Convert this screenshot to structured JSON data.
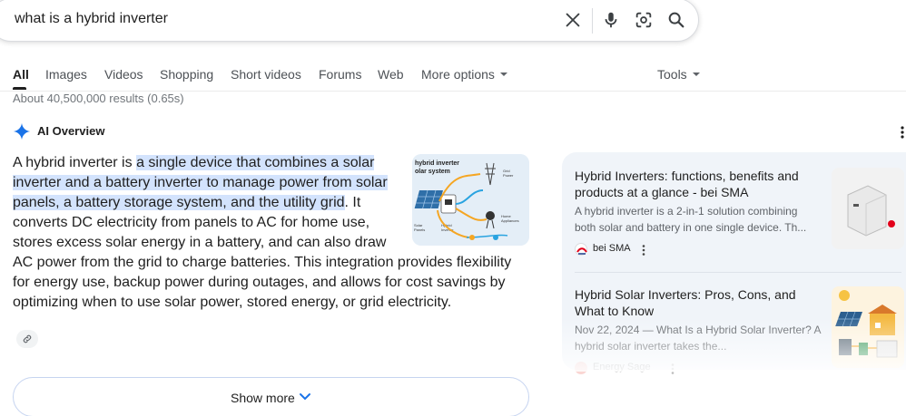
{
  "search": {
    "query": "what is a hybrid inverter"
  },
  "tabs": [
    {
      "label": "All"
    },
    {
      "label": "Images"
    },
    {
      "label": "Videos"
    },
    {
      "label": "Shopping"
    },
    {
      "label": "Short videos"
    },
    {
      "label": "Forums"
    },
    {
      "label": "Web"
    },
    {
      "label": "More options"
    }
  ],
  "tools_label": "Tools",
  "results_count": "About 40,500,000 results (0.65s)",
  "ai_overview": {
    "title": "AI Overview",
    "text_intro": "A hybrid inverter is ",
    "text_highlight": "a single device that combines a solar inverter and a battery inverter to manage power from solar panels, a battery storage system, and the utility grid",
    "text_rest": ". It converts DC electricity from panels to AC for home use, stores excess solar energy in a battery, and can also draw AC power from the grid to charge batteries. This in­tegration provides flexibility for energy use, backup power during outages, and allows for cost savings by optimizing when to use solar power, stored en­ergy, or grid electricity.",
    "image_labels": {
      "title": "hybrid inverter\nsolar system",
      "grid": "Grid\nPower",
      "panels": "Solar\nPanels",
      "hybrid": "Hybrid\nInverter",
      "home": "Home\nAppliances"
    },
    "show_more": "Show more"
  },
  "side_cards": [
    {
      "title": "Hybrid Inverters: functions, benefits and products at a glance - bei SMA",
      "snippet": "A hybrid inverter is a 2-in-1 solution combining both solar and battery in one single device. Th...",
      "source": "bei SMA"
    },
    {
      "title": "Hybrid Solar Inverters: Pros, Cons, and What to Know",
      "snippet": "Nov 22, 2024 — What Is a Hybrid Solar Inverter? A hybrid solar inverter takes the...",
      "source": "Energy Sage"
    }
  ],
  "colors": {
    "highlight": "#d3e3fd",
    "panel_bg": "#f0f4f9",
    "accent_blue": "#1a73e8"
  }
}
